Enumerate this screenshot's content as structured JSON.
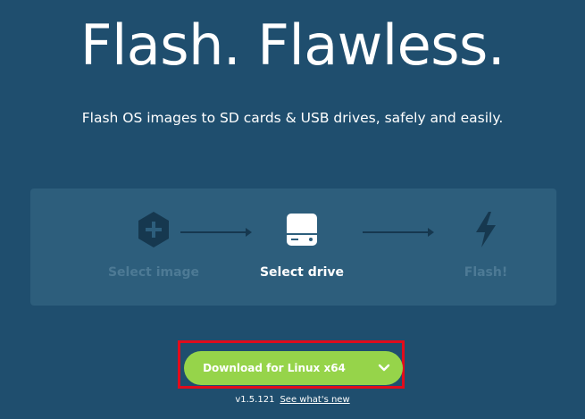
{
  "hero": {
    "title": "Flash. Flawless.",
    "subtitle": "Flash OS images to SD cards & USB drives, safely and easily."
  },
  "steps": [
    {
      "label": "Select image",
      "icon": "hexagon-plus-icon",
      "state": "inactive"
    },
    {
      "label": "Select drive",
      "icon": "drive-icon",
      "state": "active"
    },
    {
      "label": "Flash!",
      "icon": "lightning-bolt-icon",
      "state": "inactive"
    }
  ],
  "download": {
    "label": "Download for Linux x64",
    "icon": "chevron-down-icon",
    "color": "#96d44a",
    "highlight_color": "#e10c1c"
  },
  "footer": {
    "version": "v1.5.121",
    "whats_new": "See what's new"
  },
  "colors": {
    "background": "#1f4e6e",
    "panel": "#2d5e7c",
    "inactive": "#4d7a95"
  }
}
